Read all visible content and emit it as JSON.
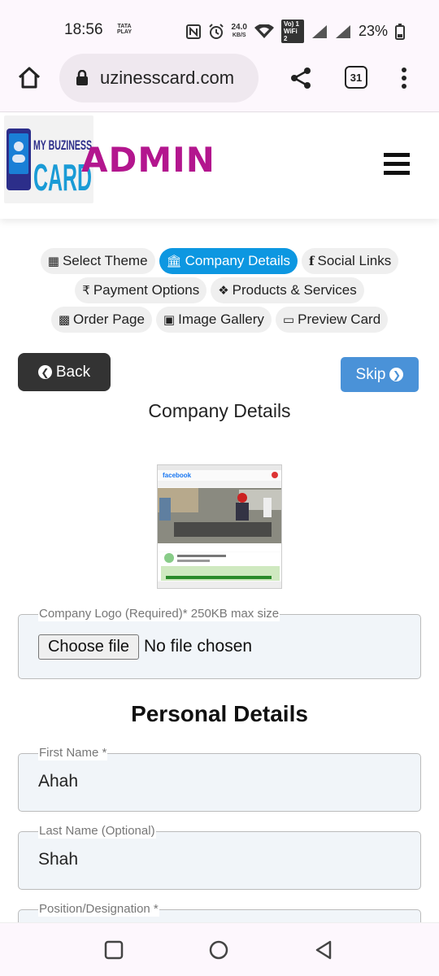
{
  "status_bar": {
    "time": "18:56",
    "carrier_badge": "TATA PLAY",
    "speed_value": "24.0",
    "speed_unit": "KB/S",
    "volte_label": "Vo) 1 WiFi 2",
    "battery": "23%"
  },
  "browser": {
    "url": "uzinesscard.com",
    "tab_count": "31"
  },
  "header": {
    "logo_text_top": "MY BUZINESS",
    "logo_text_bottom": "CARD",
    "admin_label": "ADMIN"
  },
  "steps": {
    "row1": [
      {
        "label": "Select Theme",
        "icon": "map-icon"
      },
      {
        "label": "Company Details",
        "icon": "bank-icon",
        "active": true
      },
      {
        "label": "Social Links",
        "icon": "facebook-icon"
      }
    ],
    "row2": [
      {
        "label": "Payment Options",
        "icon": "rupee-icon"
      },
      {
        "label": "Products & Services",
        "icon": "ticket-icon"
      }
    ],
    "row3": [
      {
        "label": "Order Page",
        "icon": "archive-icon"
      },
      {
        "label": "Image Gallery",
        "icon": "image-icon"
      },
      {
        "label": "Preview Card",
        "icon": "laptop-icon"
      }
    ]
  },
  "actions": {
    "back_label": "Back",
    "skip_label": "Skip"
  },
  "company": {
    "title": "Company Details",
    "logo_field_label": "Company Logo (Required)* 250KB max size",
    "choose_file_label": "Choose file",
    "no_file_text": "No file chosen",
    "preview_caption_brand": "facebook"
  },
  "personal": {
    "title": "Personal Details",
    "first_name_label": "First Name *",
    "first_name_value": "Ahah",
    "last_name_label": "Last Name (Optional)",
    "last_name_value": "Shah",
    "position_label": "Position/Designation *"
  },
  "colors": {
    "accent": "#0d97e1",
    "admin": "#b3168e",
    "skip": "#4a92d8",
    "back": "#333333"
  }
}
